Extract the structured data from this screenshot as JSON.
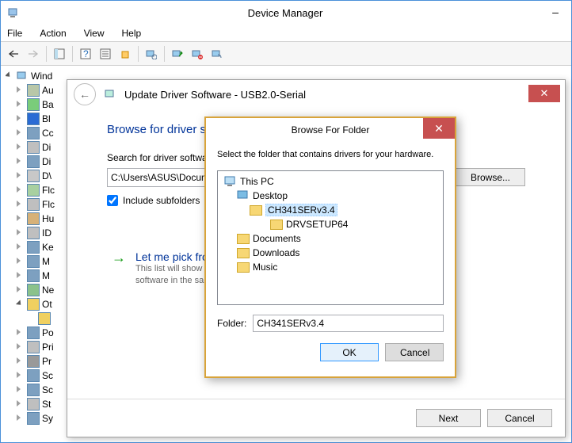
{
  "window": {
    "title": "Device Manager"
  },
  "menu": {
    "file": "File",
    "action": "Action",
    "view": "View",
    "help": "Help"
  },
  "tree": {
    "root": "Wind",
    "items": [
      "Au",
      "Ba",
      "Bl",
      "Cc",
      "Di",
      "Di",
      "D\\",
      "Flc",
      "Flc",
      "Hu",
      "ID",
      "Ke",
      "M",
      "M",
      "Ne",
      "Ot",
      "Po",
      "Pri",
      "Pr",
      "Sc",
      "Sc",
      "St",
      "Sy"
    ]
  },
  "wizard": {
    "title": "Update Driver Software - USB2.0-Serial",
    "heading": "Browse for driver software on your computer",
    "search_label": "Search for driver software in this location:",
    "path_value": "C:\\Users\\ASUS\\Documents",
    "browse_btn": "Browse...",
    "include_subfolders": "Include subfolders",
    "pick_title": "Let me pick from a list of device drivers on my computer",
    "pick_desc": "This list will show installed driver software compatible with the device, and all driver software in the same category as the device.",
    "next": "Next",
    "cancel": "Cancel"
  },
  "browse_dialog": {
    "title": "Browse For Folder",
    "instruction": "Select the folder that contains drivers for your hardware.",
    "nodes": {
      "this_pc": "This PC",
      "desktop": "Desktop",
      "ch341": "CH341SERv3.4",
      "drvsetup": "DRVSETUP64",
      "documents": "Documents",
      "downloads": "Downloads",
      "music": "Music"
    },
    "folder_label": "Folder:",
    "folder_value": "CH341SERv3.4",
    "ok": "OK",
    "cancel": "Cancel"
  }
}
